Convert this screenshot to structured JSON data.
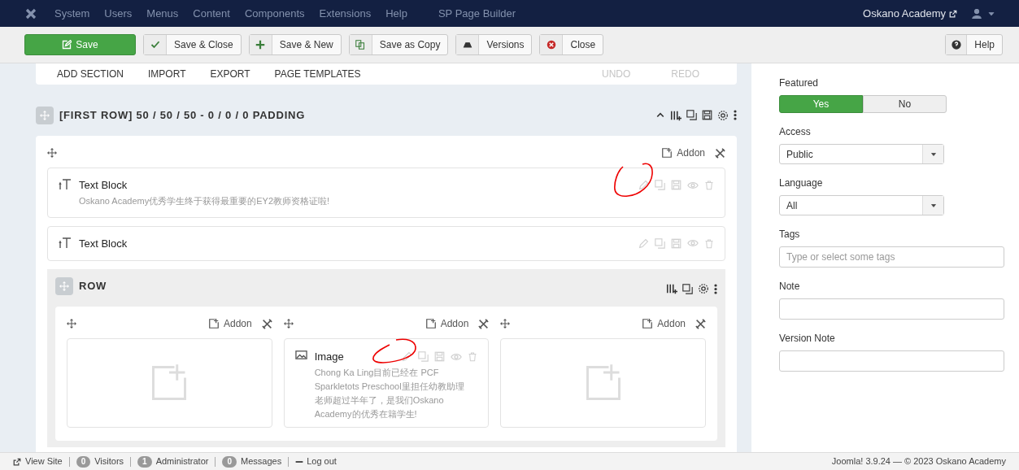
{
  "nav": {
    "menu": [
      "System",
      "Users",
      "Menus",
      "Content",
      "Components",
      "Extensions",
      "Help",
      "SP Page Builder"
    ],
    "site": "Oskano Academy"
  },
  "toolbar": {
    "buttons": [
      {
        "label": "Save",
        "kind": "save"
      },
      {
        "label": "Save & Close",
        "kind": "check"
      },
      {
        "label": "Save & New",
        "kind": "plus"
      },
      {
        "label": "Save as Copy",
        "kind": "copy"
      },
      {
        "label": "Versions",
        "kind": "versions"
      },
      {
        "label": "Close",
        "kind": "close"
      }
    ],
    "help": "Help"
  },
  "editor": {
    "actions": [
      "ADD SECTION",
      "IMPORT",
      "EXPORT",
      "PAGE TEMPLATES"
    ],
    "history": [
      "UNDO",
      "REDO"
    ],
    "section": {
      "title": "[FIRST ROW] 50 / 50 / 50 - 0 / 0 / 0 PADDING",
      "column": {
        "add_label": "Addon",
        "addons": [
          {
            "kind": "text",
            "title": "Text Block",
            "description": "Oskano Academy优秀学生终于获得最重要的EY2教师资格证啦!"
          },
          {
            "kind": "text",
            "title": "Text Block"
          }
        ],
        "inner_row": {
          "title": "ROW",
          "columns": [
            {
              "add_label": "Addon"
            },
            {
              "add_label": "Addon",
              "addons": [
                {
                  "kind": "image",
                  "title": "Image",
                  "description": "Chong Ka Ling目前已经在 PCF Sparkletots Preschool里担任幼教助理老师超过半年了，是我们Oskano Academy的优秀在籍学生!"
                }
              ]
            },
            {
              "add_label": "Addon"
            }
          ]
        }
      }
    }
  },
  "sidebar": {
    "featured": {
      "label": "Featured",
      "options": [
        {
          "label": "Yes",
          "selected": true
        },
        {
          "label": "No",
          "selected": false
        }
      ]
    },
    "fields": [
      {
        "kind": "select",
        "label": "Access",
        "value": "Public"
      },
      {
        "kind": "select",
        "label": "Language",
        "value": "All"
      },
      {
        "kind": "text",
        "label": "Tags",
        "placeholder": "Type or select some tags"
      },
      {
        "kind": "text",
        "label": "Note"
      },
      {
        "kind": "text",
        "label": "Version Note"
      }
    ]
  },
  "status_bar": {
    "items": [
      {
        "kind": "link",
        "label": "View Site"
      },
      {
        "kind": "count",
        "count": "0",
        "label": "Visitors"
      },
      {
        "kind": "count",
        "count": "1",
        "label": "Administrator"
      },
      {
        "kind": "count",
        "count": "0",
        "label": "Messages"
      },
      {
        "kind": "logout",
        "label": "Log out"
      }
    ],
    "right": "Joomla! 3.9.24 — © 2023 Oskano Academy"
  }
}
